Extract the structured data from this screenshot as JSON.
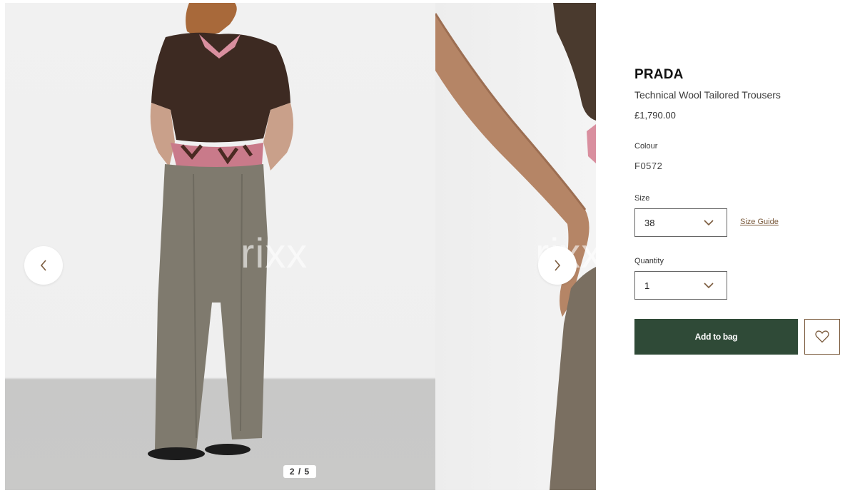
{
  "gallery": {
    "watermark": "rixx",
    "watermark_partial": "rixx",
    "counter": "2 / 5",
    "prev_label": "",
    "next_label": ""
  },
  "product": {
    "brand": "PRADA",
    "name": "Technical Wool Tailored Trousers",
    "price": "£1,790.00"
  },
  "colour": {
    "label": "Colour",
    "value": "F0572"
  },
  "size": {
    "label": "Size",
    "selected": "38",
    "guide_label": "Size Guide"
  },
  "quantity": {
    "label": "Quantity",
    "selected": "1"
  },
  "actions": {
    "add_to_bag": "Add to bag"
  },
  "icons": {
    "prev": "chevron-left-icon",
    "next": "chevron-right-icon",
    "select": "chevron-down-icon",
    "wishlist": "heart-icon"
  },
  "colors": {
    "accent": "#2f4a37",
    "link": "#7a5a3c"
  }
}
